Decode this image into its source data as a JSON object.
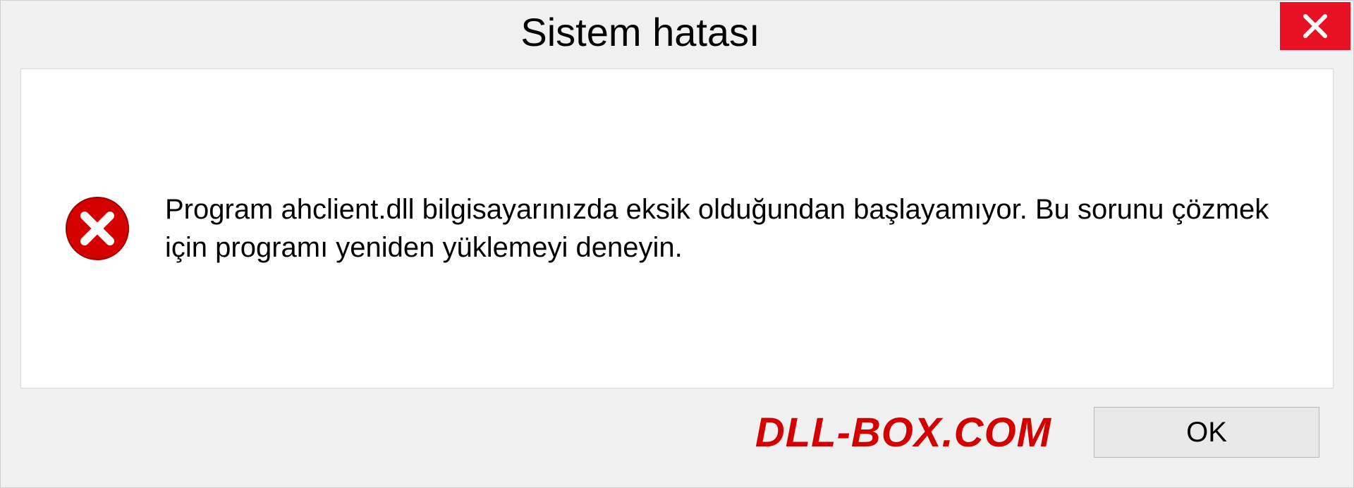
{
  "dialog": {
    "title": "Sistem hatası",
    "message": "Program ahclient.dll bilgisayarınızda eksik olduğundan başlayamıyor. Bu sorunu çözmek için programı yeniden yüklemeyi deneyin.",
    "ok_label": "OK"
  },
  "watermark": "DLL-BOX.COM",
  "colors": {
    "close_bg": "#e81123",
    "error_icon": "#d40000",
    "watermark": "#d40000"
  }
}
